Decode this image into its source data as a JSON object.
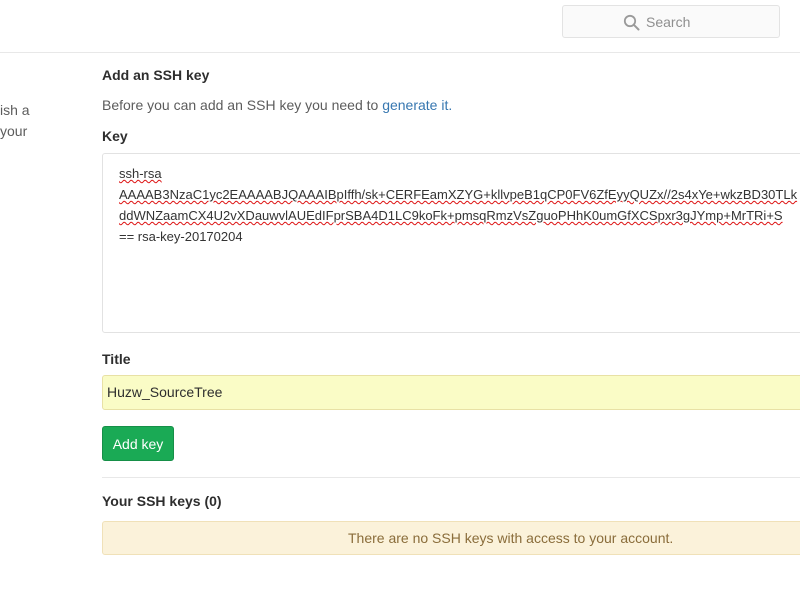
{
  "header": {
    "search_placeholder": "Search"
  },
  "sidebar": {
    "text": "ish a\nyour"
  },
  "form": {
    "section_title": "Add an SSH key",
    "intro_text": "Before you can add an SSH key you need to ",
    "intro_link": "generate it.",
    "key_label": "Key",
    "key_lines": [
      "ssh-rsa",
      "AAAAB3NzaC1yc2EAAAABJQAAAIBpIffh/sk+CERFEamXZYG+kllvpeB1qCP0FV6ZfEyyQUZx//2s4xYe+wkzBD30TLk",
      "ddWNZaamCX4U2vXDauwvlAUEdIFprSBA4D1LC9koFk+pmsqRmzVsZguoPHhK0umGfXCSpxr3gJYmp+MrTRi+S",
      "== rsa-key-20170204"
    ],
    "title_label": "Title",
    "title_value": "Huzw_SourceTree",
    "add_button_label": "Add key"
  },
  "keys": {
    "title": "Your SSH keys (0)",
    "empty_message": "There are no SSH keys with access to your account."
  },
  "colors": {
    "accent_link": "#3777b0",
    "button_green": "#1aaa55",
    "autofill_yellow": "#fafcc6",
    "notice_background": "#fbf2da"
  }
}
